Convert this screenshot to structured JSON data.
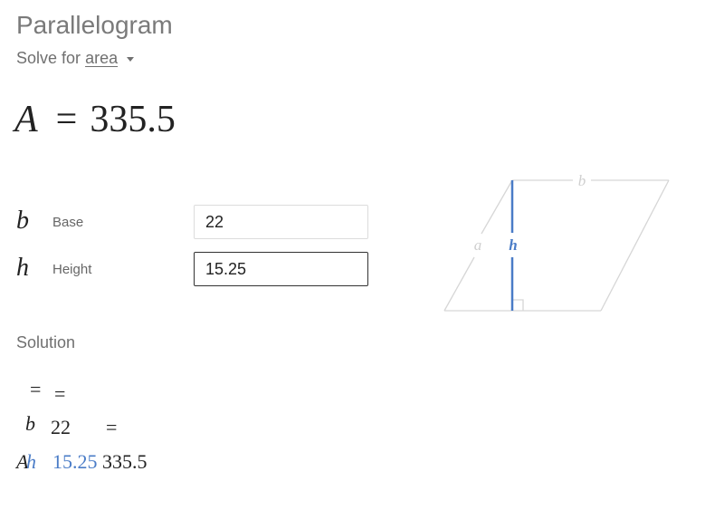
{
  "header": {
    "title": "Parallelogram",
    "solve_for_prefix": "Solve for",
    "solve_for_value": "area"
  },
  "result": {
    "variable": "A",
    "equals": "=",
    "value": "335.5"
  },
  "inputs": [
    {
      "symbol": "b",
      "label": "Base",
      "value": "22",
      "focused": false
    },
    {
      "symbol": "h",
      "label": "Height",
      "value": "15.25",
      "focused": true
    }
  ],
  "diagram": {
    "label_base": "b",
    "label_side": "a",
    "label_height": "h",
    "line_color": "#d6d6d6",
    "height_color": "#4a7cc7"
  },
  "solution": {
    "label": "Solution",
    "eq1": "=",
    "eq2": "=",
    "sym_b": "b",
    "val_b": "22",
    "eq3": "=",
    "sym_A": "A",
    "sym_h": "h",
    "val_h": "15.25",
    "val_A": "335.5"
  },
  "colors": {
    "accent_blue": "#4a7cc7",
    "muted_text": "#707070"
  }
}
